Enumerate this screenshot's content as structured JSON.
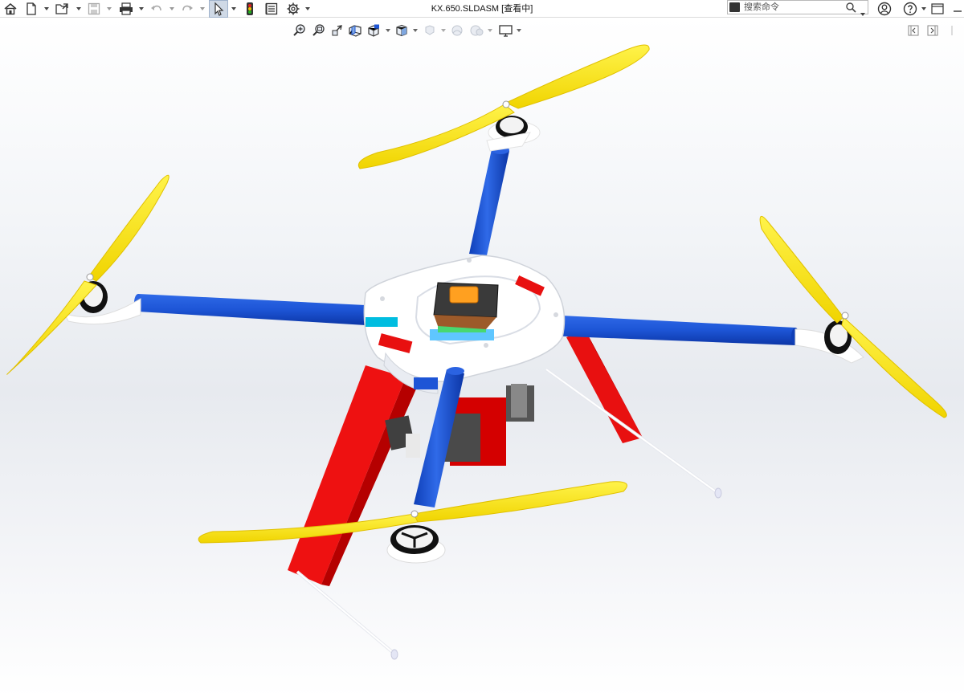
{
  "window": {
    "title": "KX.650.SLDASM [查看中]"
  },
  "search": {
    "placeholder": "搜索命令"
  },
  "toolbar": {
    "icons": [
      "home-icon",
      "new-document-icon",
      "open-icon",
      "save-icon",
      "print-icon",
      "undo-icon",
      "redo-icon",
      "select-icon",
      "rebuild-icon",
      "options-list-icon",
      "gear-icon"
    ]
  },
  "right_icons": [
    "search-icon",
    "user-icon",
    "help-icon",
    "more-icon"
  ],
  "heads_up_view": {
    "icons": [
      "zoom-to-fit-icon",
      "zoom-area-icon",
      "previous-view-icon",
      "section-view-icon",
      "dynamic-annotation-icon",
      "view-orientation-icon",
      "display-style-icon",
      "hide-show-icon",
      "edit-appearance-icon",
      "apply-scene-icon",
      "view-settings-icon"
    ]
  },
  "colors": {
    "arm": "#1f57d6",
    "propeller": "#f6e400",
    "landing_gear": "#ee1111",
    "frame": "#ffffff",
    "background_top": "#ffffff",
    "background_mid": "#e7eaef"
  }
}
